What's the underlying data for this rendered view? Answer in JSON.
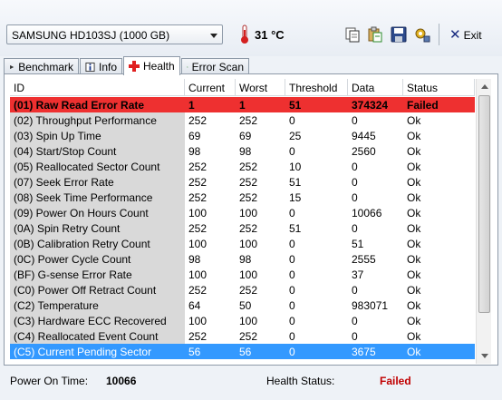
{
  "toolbar": {
    "drive": "SAMSUNG HD103SJ (1000 GB)",
    "temperature": "31 °C",
    "exit_label": "Exit",
    "icons": [
      "copy-icon",
      "paste-icon",
      "save-icon",
      "options-icon",
      "exit-icon"
    ]
  },
  "tabs": [
    {
      "label": "Benchmark",
      "icon": "benchmark-icon",
      "active": false
    },
    {
      "label": "Info",
      "icon": "info-icon",
      "active": false
    },
    {
      "label": "Health",
      "icon": "health-cross-icon",
      "active": true
    },
    {
      "label": "Error Scan",
      "icon": "magnifier-icon",
      "active": false
    }
  ],
  "table": {
    "headers": [
      "ID",
      "Current",
      "Worst",
      "Threshold",
      "Data",
      "Status"
    ],
    "rows": [
      {
        "id": "(01) Raw Read Error Rate",
        "current": "1",
        "worst": "1",
        "threshold": "51",
        "data": "374324",
        "status": "Failed",
        "state": "failed"
      },
      {
        "id": "(02) Throughput Performance",
        "current": "252",
        "worst": "252",
        "threshold": "0",
        "data": "0",
        "status": "Ok"
      },
      {
        "id": "(03) Spin Up Time",
        "current": "69",
        "worst": "69",
        "threshold": "25",
        "data": "9445",
        "status": "Ok"
      },
      {
        "id": "(04) Start/Stop Count",
        "current": "98",
        "worst": "98",
        "threshold": "0",
        "data": "2560",
        "status": "Ok"
      },
      {
        "id": "(05) Reallocated Sector Count",
        "current": "252",
        "worst": "252",
        "threshold": "10",
        "data": "0",
        "status": "Ok"
      },
      {
        "id": "(07) Seek Error Rate",
        "current": "252",
        "worst": "252",
        "threshold": "51",
        "data": "0",
        "status": "Ok"
      },
      {
        "id": "(08) Seek Time Performance",
        "current": "252",
        "worst": "252",
        "threshold": "15",
        "data": "0",
        "status": "Ok"
      },
      {
        "id": "(09) Power On Hours Count",
        "current": "100",
        "worst": "100",
        "threshold": "0",
        "data": "10066",
        "status": "Ok"
      },
      {
        "id": "(0A) Spin Retry Count",
        "current": "252",
        "worst": "252",
        "threshold": "51",
        "data": "0",
        "status": "Ok"
      },
      {
        "id": "(0B) Calibration Retry Count",
        "current": "100",
        "worst": "100",
        "threshold": "0",
        "data": "51",
        "status": "Ok"
      },
      {
        "id": "(0C) Power Cycle Count",
        "current": "98",
        "worst": "98",
        "threshold": "0",
        "data": "2555",
        "status": "Ok"
      },
      {
        "id": "(BF) G-sense Error Rate",
        "current": "100",
        "worst": "100",
        "threshold": "0",
        "data": "37",
        "status": "Ok"
      },
      {
        "id": "(C0) Power Off Retract Count",
        "current": "252",
        "worst": "252",
        "threshold": "0",
        "data": "0",
        "status": "Ok"
      },
      {
        "id": "(C2) Temperature",
        "current": "64",
        "worst": "50",
        "threshold": "0",
        "data": "983071",
        "status": "Ok"
      },
      {
        "id": "(C3) Hardware ECC Recovered",
        "current": "100",
        "worst": "100",
        "threshold": "0",
        "data": "0",
        "status": "Ok"
      },
      {
        "id": "(C4) Reallocated Event Count",
        "current": "252",
        "worst": "252",
        "threshold": "0",
        "data": "0",
        "status": "Ok"
      },
      {
        "id": "(C5) Current Pending Sector",
        "current": "56",
        "worst": "56",
        "threshold": "0",
        "data": "3675",
        "status": "Ok",
        "state": "selected"
      }
    ]
  },
  "status": {
    "power_on_label": "Power On Time:",
    "power_on_value": "10066",
    "health_label": "Health Status:",
    "health_value": "Failed"
  },
  "colors": {
    "failed_row": "#ee3030",
    "selected_row": "#3399ff",
    "failed_text": "#c00000"
  }
}
